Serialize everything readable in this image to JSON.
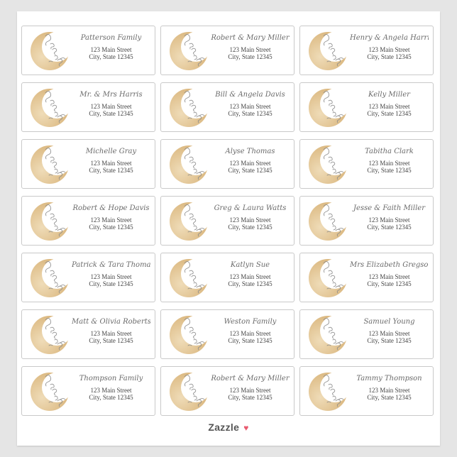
{
  "labels": [
    {
      "name": "Patterson Family",
      "street": "123 Main Street",
      "city": "City, State 12345"
    },
    {
      "name": "Robert & Mary Miller",
      "street": "123 Main Street",
      "city": "City, State 12345"
    },
    {
      "name": "Henry & Angela Harris",
      "street": "123 Main Street",
      "city": "City, State 12345"
    },
    {
      "name": "Mr. & Mrs Harris",
      "street": "123 Main Street",
      "city": "City, State 12345"
    },
    {
      "name": "Bill & Angela Davis",
      "street": "123 Main Street",
      "city": "City, State 12345"
    },
    {
      "name": "Kelly Miller",
      "street": "123 Main Street",
      "city": "City, State 12345"
    },
    {
      "name": "Michelle Gray",
      "street": "123 Main Street",
      "city": "City, State 12345"
    },
    {
      "name": "Alyse Thomas",
      "street": "123 Main Street",
      "city": "City, State 12345"
    },
    {
      "name": "Tabitha Clark",
      "street": "123 Main Street",
      "city": "City, State 12345"
    },
    {
      "name": "Robert & Hope Davis",
      "street": "123 Main Street",
      "city": "City, State 12345"
    },
    {
      "name": "Greg & Laura Watts",
      "street": "123 Main Street",
      "city": "City, State 12345"
    },
    {
      "name": "Jesse & Faith Miller",
      "street": "123 Main Street",
      "city": "City, State 12345"
    },
    {
      "name": "Patrick & Tara Thomas",
      "street": "123 Main Street",
      "city": "City, State 12345"
    },
    {
      "name": "Katlyn Sue",
      "street": "123 Main Street",
      "city": "City, State 12345"
    },
    {
      "name": "Mrs Elizabeth Gregson",
      "street": "123 Main Street",
      "city": "City, State 12345"
    },
    {
      "name": "Matt & Olivia Robertson",
      "street": "123 Main Street",
      "city": "City, State 12345"
    },
    {
      "name": "Weston Family",
      "street": "123 Main Street",
      "city": "City, State 12345"
    },
    {
      "name": "Samuel Young",
      "street": "123 Main Street",
      "city": "City, State 12345"
    },
    {
      "name": "Thompson Family",
      "street": "123 Main Street",
      "city": "City, State 12345"
    },
    {
      "name": "Robert & Mary Miller",
      "street": "123 Main Street",
      "city": "City, State 12345"
    },
    {
      "name": "Tammy Thompson",
      "street": "123 Main Street",
      "city": "City, State 12345"
    }
  ],
  "footer": {
    "brand": "Zazzle",
    "heart": "♥"
  },
  "colors": {
    "moon_gold": "#d9b47a",
    "moon_light": "#efdcb8",
    "script_gray": "#8a8a8a",
    "heart": "#e85a6f"
  }
}
